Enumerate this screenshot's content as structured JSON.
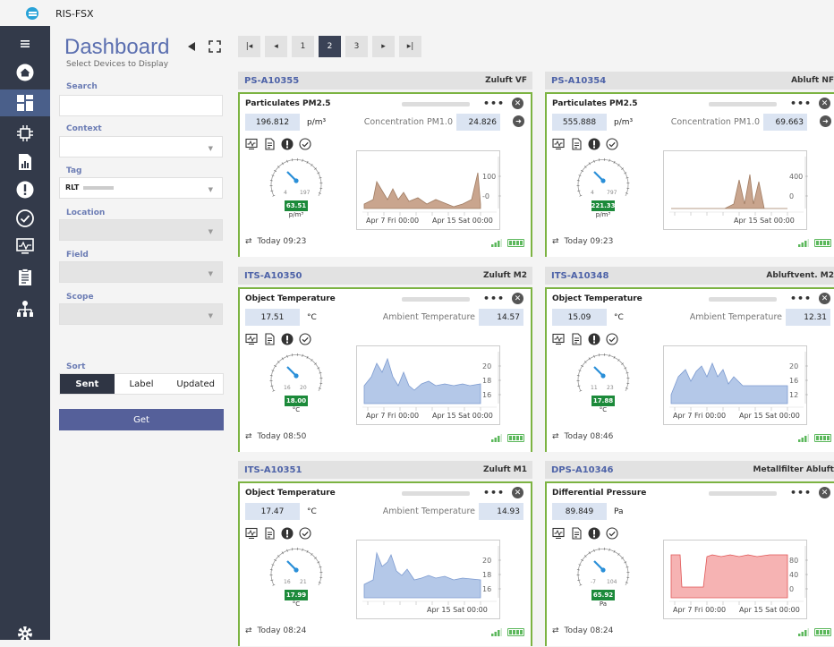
{
  "app": {
    "title": "RIS-FSX"
  },
  "sidebar": {
    "items": [
      {
        "name": "menu-icon"
      },
      {
        "name": "home-icon"
      },
      {
        "name": "dashboard-icon"
      },
      {
        "name": "devices-icon"
      },
      {
        "name": "reports-icon"
      },
      {
        "name": "alerts-icon"
      },
      {
        "name": "check-icon"
      },
      {
        "name": "monitor-icon"
      },
      {
        "name": "clipboard-icon"
      },
      {
        "name": "network-icon"
      },
      {
        "name": "settings-icon"
      }
    ]
  },
  "panel": {
    "title": "Dashboard",
    "subtitle": "Select Devices to Display",
    "search_label": "Search",
    "context_label": "Context",
    "tag_label": "Tag",
    "tag_value": "RLT",
    "location_label": "Location",
    "field_label": "Field",
    "scope_label": "Scope",
    "sort_label": "Sort",
    "sort_options": [
      "Sent",
      "Label",
      "Updated"
    ],
    "get_label": "Get"
  },
  "pager": {
    "first": "|◂",
    "prev": "◂",
    "pages": [
      "1",
      "2",
      "3"
    ],
    "next": "▸",
    "last": "▸|",
    "current": "2"
  },
  "cards": [
    {
      "id": "PS-A10355",
      "label": "Zuluft VF",
      "field": "Particulates PM2.5",
      "value": "196.812",
      "unit": "p/m³",
      "aux_label": "Concentration PM1.0",
      "aux_value": "24.826",
      "has_arrow": true,
      "gauge_min": "4",
      "gauge_max": "197",
      "gauge_value": "63.51",
      "gauge_unit": "p/m³",
      "chart_color": "#c9a58e",
      "chart_stroke": "#a07c62",
      "y_ticks": [
        "100",
        "-0"
      ],
      "x_labels": [
        "Apr 7 Fri 00:00",
        "Apr 15 Sat 00:00"
      ],
      "time": "Today 09:23"
    },
    {
      "id": "PS-A10354",
      "label": "Abluft NF",
      "field": "Particulates PM2.5",
      "value": "555.888",
      "unit": "p/m³",
      "aux_label": "Concentration PM1.0",
      "aux_value": "69.663",
      "has_arrow": true,
      "gauge_min": "4",
      "gauge_max": "797",
      "gauge_value": "221.33",
      "gauge_unit": "p/m³",
      "chart_color": "#c9a58e",
      "chart_stroke": "#a07c62",
      "y_ticks": [
        "400",
        "0"
      ],
      "x_labels": [
        "Apr 15 Sat 00:00"
      ],
      "time": "Today 09:23"
    },
    {
      "id": "ITS-A10350",
      "label": "Zuluft M2",
      "field": "Object Temperature",
      "value": "17.51",
      "unit": "°C",
      "aux_label": "Ambient Temperature",
      "aux_value": "14.57",
      "has_arrow": false,
      "gauge_min": "16",
      "gauge_max": "20",
      "gauge_value": "18.00",
      "gauge_unit": "°C",
      "chart_color": "#b4c8e8",
      "chart_stroke": "#7d9bd0",
      "y_ticks": [
        "20",
        "18",
        "16"
      ],
      "x_labels": [
        "Apr 7 Fri 00:00",
        "Apr 15 Sat 00:00"
      ],
      "time": "Today 08:50"
    },
    {
      "id": "ITS-A10348",
      "label": "Abluftvent. M2",
      "field": "Object Temperature",
      "value": "15.09",
      "unit": "°C",
      "aux_label": "Ambient Temperature",
      "aux_value": "12.31",
      "has_arrow": false,
      "gauge_min": "11",
      "gauge_max": "23",
      "gauge_value": "17.88",
      "gauge_unit": "°C",
      "chart_color": "#b4c8e8",
      "chart_stroke": "#7d9bd0",
      "y_ticks": [
        "20",
        "16",
        "12"
      ],
      "x_labels": [
        "Apr 7 Fri 00:00",
        "Apr 15 Sat 00:00"
      ],
      "time": "Today 08:46"
    },
    {
      "id": "ITS-A10351",
      "label": "Zuluft M1",
      "field": "Object Temperature",
      "value": "17.47",
      "unit": "°C",
      "aux_label": "Ambient Temperature",
      "aux_value": "14.93",
      "has_arrow": false,
      "gauge_min": "16",
      "gauge_max": "21",
      "gauge_value": "17.99",
      "gauge_unit": "°C",
      "chart_color": "#b4c8e8",
      "chart_stroke": "#7d9bd0",
      "y_ticks": [
        "20",
        "18",
        "16"
      ],
      "x_labels": [
        "Apr 15 Sat 00:00"
      ],
      "time": "Today 08:24"
    },
    {
      "id": "DPS-A10346",
      "label": "Metallfilter Abluft",
      "field": "Differential Pressure",
      "value": "89.849",
      "unit": "Pa",
      "aux_label": "",
      "aux_value": "",
      "has_arrow": false,
      "gauge_min": "-7",
      "gauge_max": "104",
      "gauge_value": "65.92",
      "gauge_unit": "Pa",
      "chart_color": "#f6b3b3",
      "chart_stroke": "#e05555",
      "y_ticks": [
        "80",
        "40",
        "0"
      ],
      "x_labels": [
        "Apr 7 Fri 00:00",
        "Apr 15 Sat 00:00"
      ],
      "time": "Today 08:24"
    }
  ]
}
